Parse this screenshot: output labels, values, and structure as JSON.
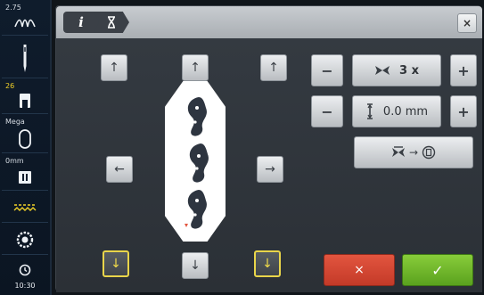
{
  "sidebar": {
    "items": [
      {
        "id": "upper-thread-tension",
        "value": "2.75",
        "icon": "thread-tension-icon"
      },
      {
        "id": "needle",
        "value": "",
        "icon": "needle-icon"
      },
      {
        "id": "presser-foot",
        "value": "26",
        "icon": "presser-foot-icon"
      },
      {
        "id": "hoop",
        "value": "Mega",
        "icon": "hoop-icon"
      },
      {
        "id": "needle-plate",
        "value": "0mm",
        "icon": "needle-plate-icon"
      },
      {
        "id": "feed-dog",
        "value": "",
        "icon": "feed-dog-icon"
      },
      {
        "id": "bobbin",
        "value": "",
        "icon": "bobbin-icon"
      },
      {
        "id": "clock",
        "value": "10:30",
        "icon": "clock-icon"
      }
    ]
  },
  "topbar": {
    "info_label": "i",
    "mode_icon": "hourglass-icon",
    "close_label": "×"
  },
  "arrows": {
    "up": "↑",
    "down": "↓",
    "left": "←",
    "right": "→"
  },
  "controls": {
    "minus": "−",
    "plus": "+",
    "repeat_count": "3 x",
    "distance": "0.0 mm",
    "reset_label": "→",
    "cancel": "×",
    "confirm": "✓"
  },
  "colors": {
    "accent_yellow": "#e9d54a",
    "cancel_red": "#d1452f",
    "confirm_green": "#72b82c"
  }
}
